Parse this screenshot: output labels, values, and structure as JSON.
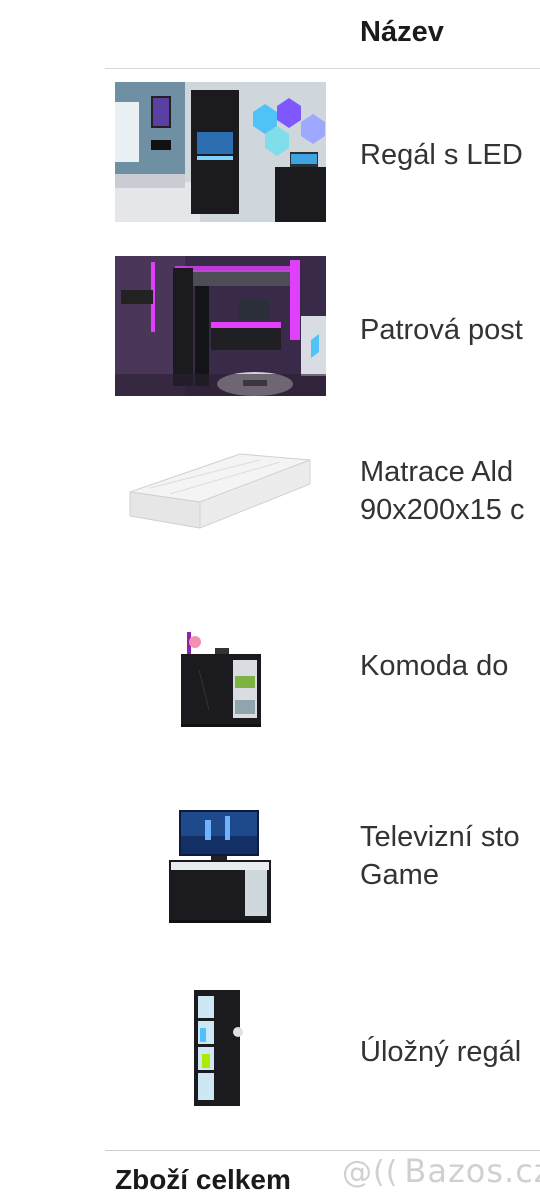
{
  "table": {
    "column_name_header": "Název"
  },
  "products": [
    {
      "name": "Regál s LED",
      "image": "led-shelf-room-photo"
    },
    {
      "name": "Patrová post",
      "image": "loft-bed-room-photo"
    },
    {
      "name": "Matrace Ald\n90x200x15 c",
      "image": "mattress-photo"
    },
    {
      "name": "Komoda do",
      "image": "dresser-photo"
    },
    {
      "name": "Televizní sto\nGame",
      "image": "tv-stand-photo"
    },
    {
      "name": "Úložný regál",
      "image": "storage-shelf-photo"
    }
  ],
  "footer": {
    "total_label": "Zboží celkem"
  },
  "watermark": {
    "text": "Bazos.cz",
    "logo": "@(("
  },
  "colors": {
    "text": "#333333",
    "divider": "#d8d8d8",
    "furniture_dark": "#1b1b1f",
    "neon_pink": "#e040fb",
    "neon_blue": "#4fc3f7"
  }
}
